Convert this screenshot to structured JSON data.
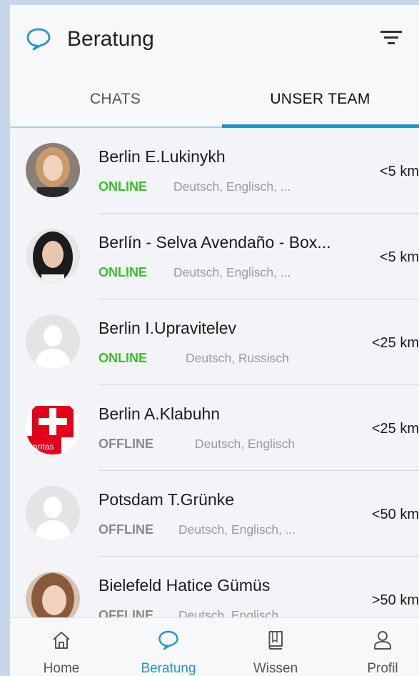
{
  "header": {
    "title": "Beratung",
    "logo_icon": "chat-bubble-icon",
    "filter_icon": "filter-icon",
    "accent": "#2493d1"
  },
  "tabs": [
    {
      "label": "CHATS",
      "active": false
    },
    {
      "label": "UNSER TEAM",
      "active": true
    }
  ],
  "counselors": [
    {
      "name": "Berlin E.Lukinykh",
      "status": "ONLINE",
      "languages": "Deutsch, Englisch, ...",
      "distance": "<5 km",
      "avatar": "photo-woman-curly-hair"
    },
    {
      "name": "Berlín - Selva Avendaño - Box...",
      "status": "ONLINE",
      "languages": "Deutsch, Englisch, ...",
      "distance": "<5 km",
      "avatar": "photo-woman-dark-hair"
    },
    {
      "name": "Berlin I.Upravitelev",
      "status": "ONLINE",
      "languages": "Deutsch, Russisch",
      "distance": "<25 km",
      "avatar": "default-user-avatar"
    },
    {
      "name": "Berlin A.Klabuhn",
      "status": "OFFLINE",
      "languages": "Deutsch, Englisch",
      "distance": "<25 km",
      "avatar": "caritas-logo"
    },
    {
      "name": "Potsdam T.Grünke",
      "status": "OFFLINE",
      "languages": "Deutsch, Englisch, ...",
      "distance": "<50 km",
      "avatar": "default-user-avatar"
    },
    {
      "name": "Bielefeld Hatice Gümüs",
      "status": "OFFLINE",
      "languages": "Deutsch, Englisch",
      "distance": ">50 km",
      "avatar": "photo-woman-brown-hair"
    }
  ],
  "logo_text": {
    "caritas": "caritas"
  },
  "bottom_nav": [
    {
      "label": "Home",
      "icon": "home-icon",
      "active": false
    },
    {
      "label": "Beratung",
      "icon": "chat-bubble-icon",
      "active": true
    },
    {
      "label": "Wissen",
      "icon": "book-icon",
      "active": false
    },
    {
      "label": "Profil",
      "icon": "user-icon",
      "active": false
    }
  ],
  "colors": {
    "online": "#39c02b",
    "offline": "#8a8a8a",
    "active_nav": "#2493d1",
    "inactive_nav": "#555555"
  }
}
